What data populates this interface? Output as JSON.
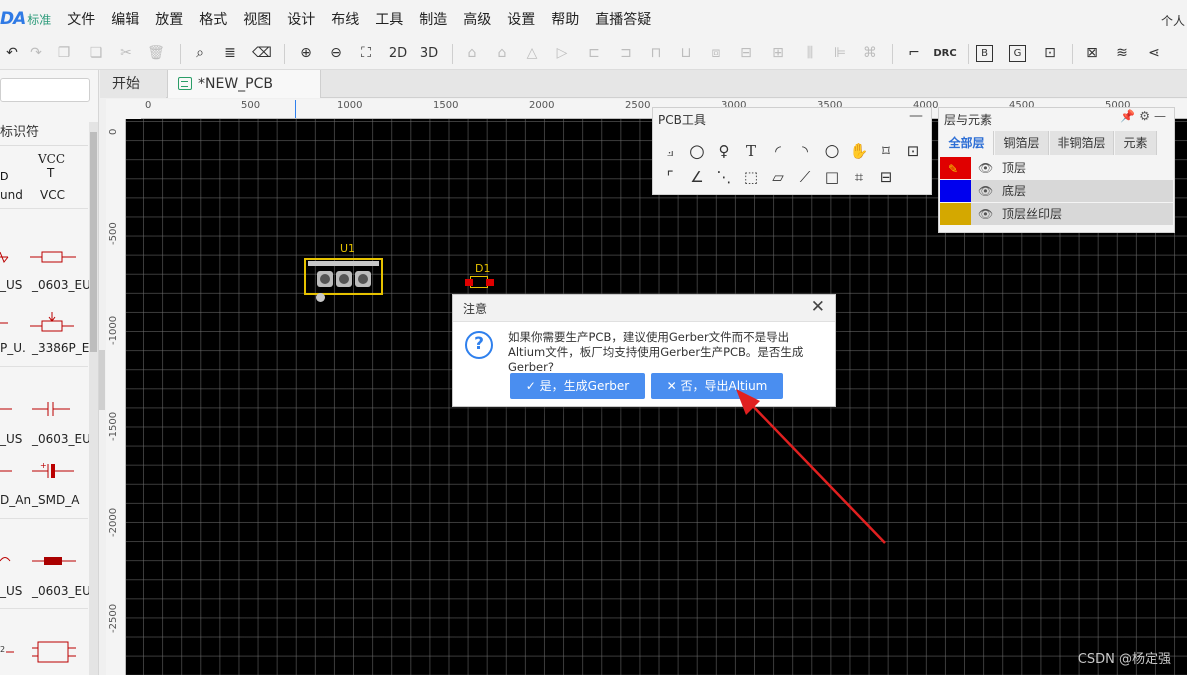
{
  "app": {
    "logo": "DA",
    "edition": "标准",
    "user_corner": "个人"
  },
  "menu": [
    "文件",
    "编辑",
    "放置",
    "格式",
    "视图",
    "设计",
    "布线",
    "工具",
    "制造",
    "高级",
    "设置",
    "帮助",
    "直播答疑"
  ],
  "toolbar": {
    "btn_2d": "2D",
    "btn_3d": "3D",
    "btn_drc": "DRC",
    "btn_b": "B",
    "btn_g": "G"
  },
  "library": {
    "header": "标识符",
    "items": [
      {
        "label": "und"
      },
      {
        "label": "VCC"
      },
      {
        "label": "_US"
      },
      {
        "label": "_0603_EU"
      },
      {
        "label": "P_U."
      },
      {
        "label": "_3386P_E"
      },
      {
        "label": "_US"
      },
      {
        "label": "_0603_EU"
      },
      {
        "label": "D_An"
      },
      {
        "label": "_SMD_A"
      },
      {
        "label": "_US"
      },
      {
        "label": "_0603_EU"
      }
    ],
    "vcc_symbol": "VCC"
  },
  "tabs": {
    "start": "开始",
    "pcb": "*NEW_PCB"
  },
  "ruler": {
    "x": [
      "0",
      "500",
      "1000",
      "1500",
      "2000",
      "2500",
      "3000",
      "3500",
      "4000",
      "4500",
      "5000"
    ],
    "y": [
      "0",
      "-500",
      "-1000",
      "-1500",
      "-2000",
      "-2500"
    ]
  },
  "components": {
    "u1": "U1",
    "d1": "D1"
  },
  "pcb_tools": {
    "title": "PCB工具",
    "minimize": "—"
  },
  "layers_panel": {
    "title": "层与元素",
    "tabs": [
      "全部层",
      "铜箔层",
      "非铜箔层",
      "元素"
    ],
    "rows": [
      {
        "name": "顶层",
        "color": "#e00000"
      },
      {
        "name": "底层",
        "color": "#0000ee"
      },
      {
        "name": "顶层丝印层",
        "color": "#d4a800"
      }
    ]
  },
  "dialog": {
    "title": "注意",
    "icon": "?",
    "message": "如果你需要生产PCB，建议使用Gerber文件而不是导出Altium文件，板厂均支持使用Gerber生产PCB。是否生成Gerber?",
    "yes_label": "是，生成Gerber",
    "no_label": "否，导出Altium"
  },
  "watermark": "CSDN @杨定强"
}
